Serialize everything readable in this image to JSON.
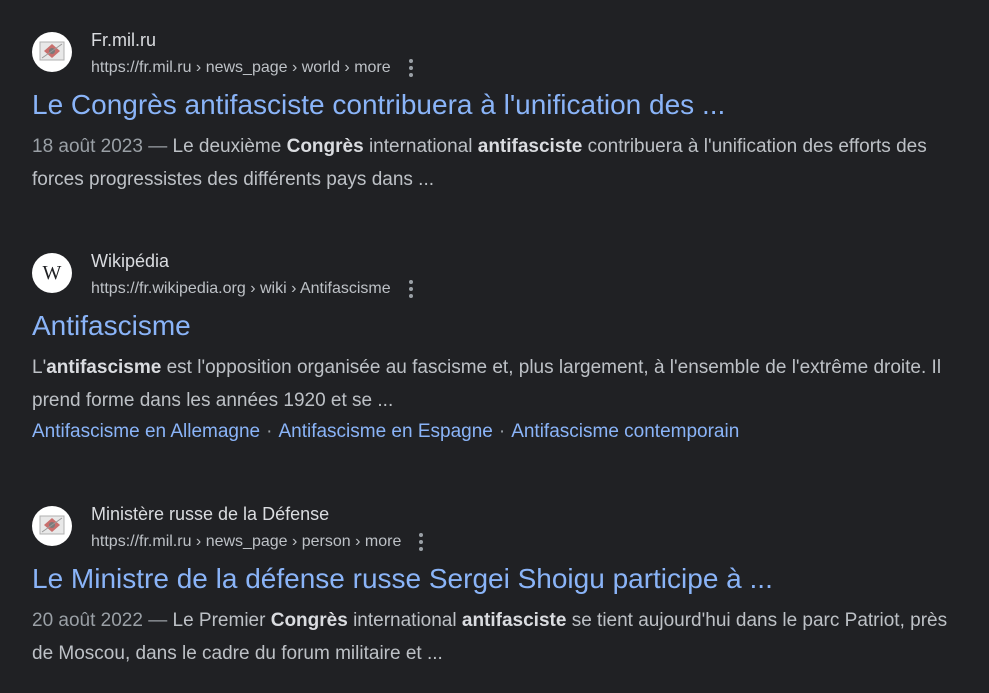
{
  "results": [
    {
      "favicon": "mil-ru-emblem-icon",
      "site_name": "Fr.mil.ru",
      "url": "https://fr.mil.ru › news_page › world › more",
      "title": "Le Congrès antifasciste contribuera à l'unification des ...",
      "snippet": {
        "date": "18 août 2023",
        "dash": " — ",
        "p1": "Le deuxième ",
        "b1": "Congrès",
        "p2": " international ",
        "b2": "antifasciste",
        "p3": " contribuera à l'unification des efforts des forces progressistes des différents pays dans ..."
      }
    },
    {
      "favicon": "wikipedia-w-icon",
      "favicon_letter": "W",
      "site_name": "Wikipédia",
      "url": "https://fr.wikipedia.org › wiki › Antifascisme",
      "title": "Antifascisme",
      "snippet": {
        "p1": "L'",
        "b1": "antifascisme",
        "p2": " est l'opposition organisée au fascisme et, plus largement, à l'ensemble de l'extrême droite. Il prend forme dans les années 1920 et se ..."
      },
      "sitelinks": [
        "Antifascisme en Allemagne",
        "Antifascisme en Espagne",
        "Antifascisme contemporain"
      ],
      "sitelink_separator": "·"
    },
    {
      "favicon": "mil-ru-emblem-icon",
      "site_name": "Ministère russe de la Défense",
      "url": "https://fr.mil.ru › news_page › person › more",
      "title": "Le Ministre de la défense russe Sergei Shoigu participe à ...",
      "snippet": {
        "date": "20 août 2022",
        "dash": " — ",
        "p1": "Le Premier ",
        "b1": "Congrès",
        "p2": " international ",
        "b2": "antifasciste",
        "p3": " se tient aujourd'hui dans le parc Patriot, près de Moscou, dans le cadre du forum militaire et ..."
      }
    }
  ],
  "colors": {
    "background": "#202124",
    "link": "#8ab4f8",
    "text": "#bdc1c6",
    "muted": "#9aa0a6"
  }
}
